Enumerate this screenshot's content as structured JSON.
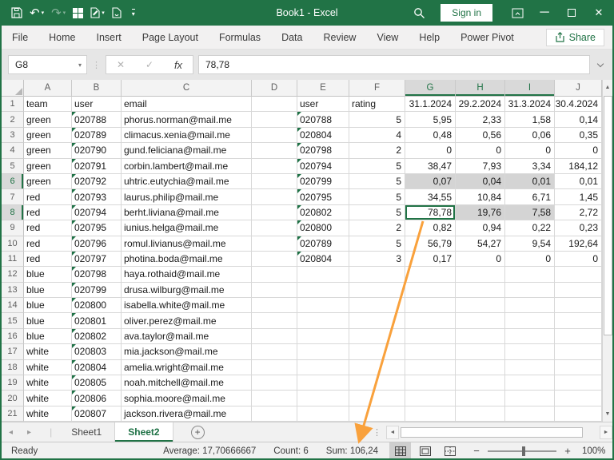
{
  "window": {
    "title": "Book1 - Excel",
    "sign_in_label": "Sign in"
  },
  "icons": {
    "undo": "↶",
    "redo": "↷",
    "caret_down": "▾",
    "minimize": "─",
    "close": "✕",
    "cancel": "✕",
    "check": "✓",
    "fx": "fx",
    "dots": "⋮",
    "nav_left": "◂",
    "nav_right": "▸",
    "scroll_up": "▲",
    "scroll_down": "▼",
    "scroll_left": "◄",
    "scroll_right": "►",
    "new_sheet": "+",
    "zoom_minus": "−",
    "zoom_plus": "+"
  },
  "ribbon": {
    "tabs": [
      "File",
      "Home",
      "Insert",
      "Page Layout",
      "Formulas",
      "Data",
      "Review",
      "View",
      "Help",
      "Power Pivot"
    ],
    "share_label": "Share"
  },
  "formula_bar": {
    "name_box": "G8",
    "value": "78,78"
  },
  "grid": {
    "columns": [
      "A",
      "B",
      "C",
      "D",
      "E",
      "F",
      "G",
      "H",
      "I",
      "J"
    ],
    "rows": [
      {
        "n": 1,
        "cells": [
          "team",
          "user",
          "email",
          "",
          "user",
          "rating",
          "31.1.2024",
          "29.2.2024",
          "31.3.2024",
          "30.4.2024"
        ]
      },
      {
        "n": 2,
        "cells": [
          "green",
          "020788",
          "phorus.norman@mail.me",
          "",
          "020788",
          "5",
          "5,95",
          "2,33",
          "1,58",
          "0,14"
        ]
      },
      {
        "n": 3,
        "cells": [
          "green",
          "020789",
          "climacus.xenia@mail.me",
          "",
          "020804",
          "4",
          "0,48",
          "0,56",
          "0,06",
          "0,35"
        ]
      },
      {
        "n": 4,
        "cells": [
          "green",
          "020790",
          "gund.feliciana@mail.me",
          "",
          "020798",
          "2",
          "0",
          "0",
          "0",
          "0"
        ]
      },
      {
        "n": 5,
        "cells": [
          "green",
          "020791",
          "corbin.lambert@mail.me",
          "",
          "020794",
          "5",
          "38,47",
          "7,93",
          "3,34",
          "184,12"
        ]
      },
      {
        "n": 6,
        "cells": [
          "green",
          "020792",
          "uhtric.eutychia@mail.me",
          "",
          "020799",
          "5",
          "0,07",
          "0,04",
          "0,01",
          "0,01"
        ]
      },
      {
        "n": 7,
        "cells": [
          "red",
          "020793",
          "laurus.philip@mail.me",
          "",
          "020795",
          "5",
          "34,55",
          "10,84",
          "6,71",
          "1,45"
        ]
      },
      {
        "n": 8,
        "cells": [
          "red",
          "020794",
          "berht.liviana@mail.me",
          "",
          "020802",
          "5",
          "78,78",
          "19,76",
          "7,58",
          "2,72"
        ]
      },
      {
        "n": 9,
        "cells": [
          "red",
          "020795",
          "iunius.helga@mail.me",
          "",
          "020800",
          "2",
          "0,82",
          "0,94",
          "0,22",
          "0,23"
        ]
      },
      {
        "n": 10,
        "cells": [
          "red",
          "020796",
          "romul.livianus@mail.me",
          "",
          "020789",
          "5",
          "56,79",
          "54,27",
          "9,54",
          "192,64"
        ]
      },
      {
        "n": 11,
        "cells": [
          "red",
          "020797",
          "photina.boda@mail.me",
          "",
          "020804",
          "3",
          "0,17",
          "0",
          "0",
          "0"
        ]
      },
      {
        "n": 12,
        "cells": [
          "blue",
          "020798",
          "haya.rothaid@mail.me",
          "",
          "",
          "",
          "",
          "",
          "",
          ""
        ]
      },
      {
        "n": 13,
        "cells": [
          "blue",
          "020799",
          "drusa.wilburg@mail.me",
          "",
          "",
          "",
          "",
          "",
          "",
          ""
        ]
      },
      {
        "n": 14,
        "cells": [
          "blue",
          "020800",
          "isabella.white@mail.me",
          "",
          "",
          "",
          "",
          "",
          "",
          ""
        ]
      },
      {
        "n": 15,
        "cells": [
          "blue",
          "020801",
          "oliver.perez@mail.me",
          "",
          "",
          "",
          "",
          "",
          "",
          ""
        ]
      },
      {
        "n": 16,
        "cells": [
          "blue",
          "020802",
          "ava.taylor@mail.me",
          "",
          "",
          "",
          "",
          "",
          "",
          ""
        ]
      },
      {
        "n": 17,
        "cells": [
          "white",
          "020803",
          "mia.jackson@mail.me",
          "",
          "",
          "",
          "",
          "",
          "",
          ""
        ]
      },
      {
        "n": 18,
        "cells": [
          "white",
          "020804",
          "amelia.wright@mail.me",
          "",
          "",
          "",
          "",
          "",
          "",
          ""
        ]
      },
      {
        "n": 19,
        "cells": [
          "white",
          "020805",
          "noah.mitchell@mail.me",
          "",
          "",
          "",
          "",
          "",
          "",
          ""
        ]
      },
      {
        "n": 20,
        "cells": [
          "white",
          "020806",
          "sophia.moore@mail.me",
          "",
          "",
          "",
          "",
          "",
          "",
          ""
        ]
      },
      {
        "n": 21,
        "cells": [
          "white",
          "020807",
          "jackson.rivera@mail.me",
          "",
          "",
          "",
          "",
          "",
          "",
          ""
        ]
      }
    ],
    "selection": {
      "active_cell": "G8",
      "filled_cells": [
        "G6",
        "H6",
        "I6",
        "H8",
        "I8"
      ],
      "selected_columns": [
        "G",
        "H",
        "I"
      ],
      "selected_rows": [
        6,
        8
      ]
    }
  },
  "sheet_bar": {
    "tabs": [
      {
        "label": "Sheet1",
        "active": false
      },
      {
        "label": "Sheet2",
        "active": true
      }
    ]
  },
  "status_bar": {
    "mode": "Ready",
    "aggregates": [
      "Average: 17,70666667",
      "Count: 6",
      "Sum: 106,24"
    ],
    "zoom_level": "100%"
  },
  "annotation": {
    "arrow_color": "#F9A13C"
  },
  "colors": {
    "excel_green": "#217346",
    "selection_fill": "#D4D4D4"
  }
}
